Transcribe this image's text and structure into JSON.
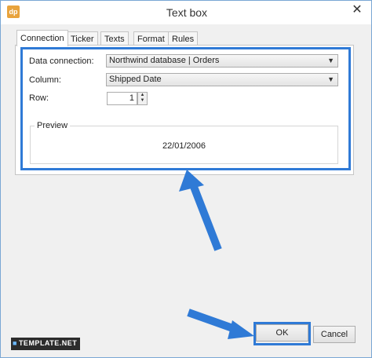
{
  "window": {
    "title": "Text box",
    "app_icon": "dp",
    "close_glyph": "✕"
  },
  "tabs": [
    {
      "label": "Connection",
      "active": true
    },
    {
      "label": "Ticker",
      "active": false
    },
    {
      "label": "Texts",
      "active": false
    },
    {
      "label": "Format",
      "active": false
    },
    {
      "label": "Rules",
      "active": false
    }
  ],
  "form": {
    "data_connection_label": "Data connection:",
    "data_connection_value": "Northwind database | Orders",
    "column_label": "Column:",
    "column_value": "Shipped Date",
    "row_label": "Row:",
    "row_value": "1"
  },
  "preview": {
    "legend": "Preview",
    "value": "22/01/2006"
  },
  "buttons": {
    "ok": "OK",
    "cancel": "Cancel"
  },
  "watermark": {
    "text": "TEMPLATE.NET"
  },
  "colors": {
    "highlight": "#2f7ad6",
    "app_icon": "#e8a33d"
  },
  "icons": [
    "dp-app-icon",
    "close-icon",
    "chevron-down-icon",
    "spin-up-icon",
    "spin-down-icon",
    "arrow-annotation-icon"
  ]
}
